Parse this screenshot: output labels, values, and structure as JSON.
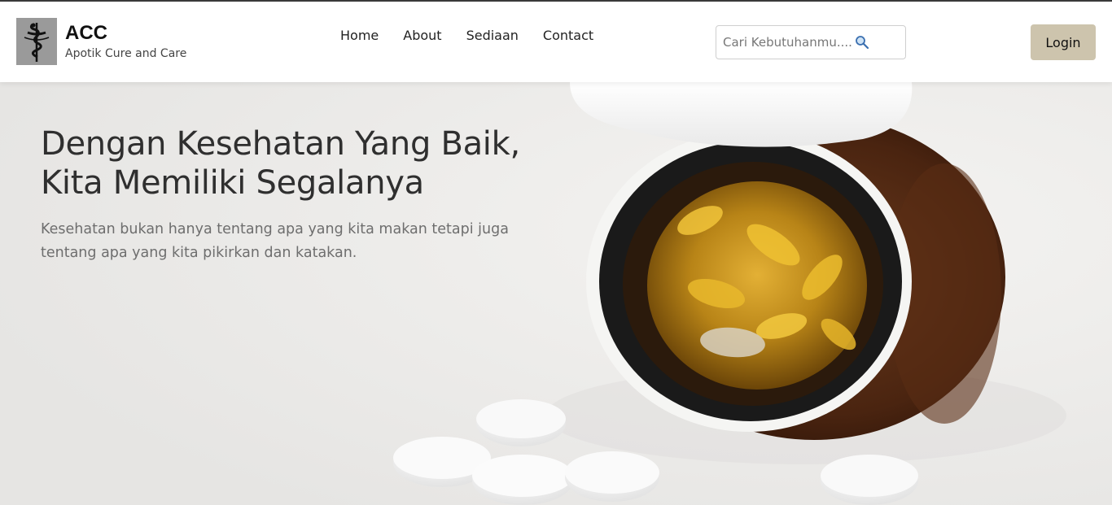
{
  "brand": {
    "title": "ACC",
    "subtitle": "Apotik Cure and Care",
    "logo_icon": "caduceus-icon"
  },
  "nav": {
    "items": [
      {
        "label": "Home"
      },
      {
        "label": "About"
      },
      {
        "label": "Sediaan"
      },
      {
        "label": "Contact"
      }
    ]
  },
  "search": {
    "placeholder": "Cari Kebutuhanmu......",
    "icon": "search-icon"
  },
  "login": {
    "label": "Login"
  },
  "hero": {
    "title": "Dengan Kesehatan Yang Baik, Kita Memiliki Segalanya",
    "text": "Kesehatan bukan hanya tentang apa yang kita makan tetapi juga tentang apa yang kita pikirkan dan katakan.",
    "image_icon": "pill-bottle-image"
  },
  "colors": {
    "login_button": "#cdc4ad",
    "navbar_bg": "#ffffff",
    "hero_title": "#2f2f2f",
    "hero_text": "#6e6e6e"
  }
}
